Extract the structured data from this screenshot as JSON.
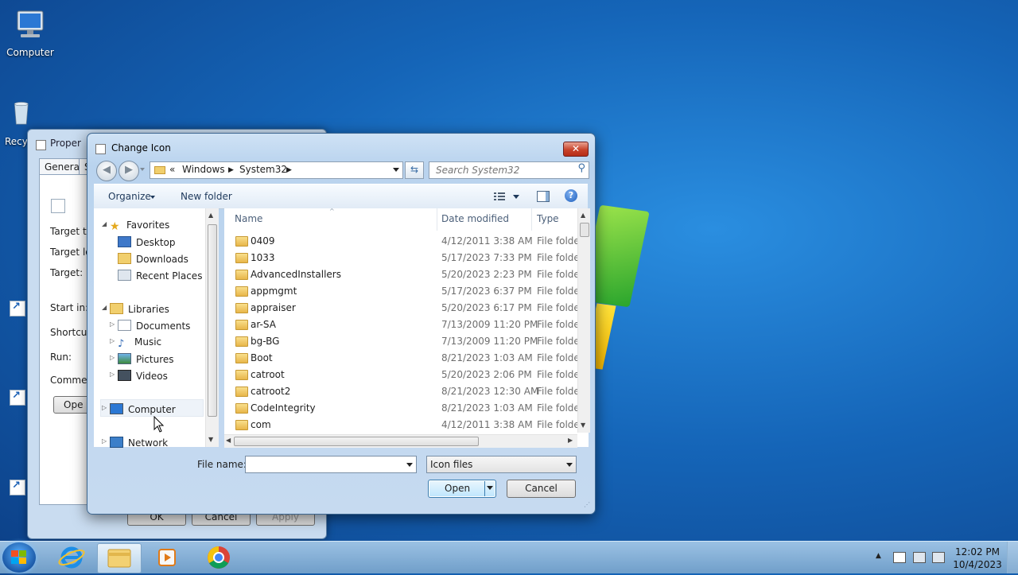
{
  "desktop": {
    "icons": [
      {
        "label": "Computer"
      },
      {
        "label": "Recy"
      }
    ]
  },
  "properties_window": {
    "title": "Proper",
    "tabs": [
      "General",
      "S"
    ],
    "labels": [
      "Target ty",
      "Target lo",
      "Target:",
      "Start in:",
      "Shortcut",
      "Run:",
      "Commen"
    ],
    "open_button": "Ope",
    "buttons": {
      "ok": "OK",
      "cancel": "Cancel",
      "apply": "Apply"
    }
  },
  "dialog": {
    "title": "Change Icon",
    "close": "✕",
    "address": {
      "chevron": "«",
      "segments": [
        "Windows",
        "System32"
      ]
    },
    "search": {
      "placeholder": "Search System32"
    },
    "toolbar": {
      "organize": "Organize",
      "new_folder": "New folder",
      "help": "?"
    },
    "tree": {
      "favorites": "Favorites",
      "desktop": "Desktop",
      "downloads": "Downloads",
      "recent": "Recent Places",
      "libraries": "Libraries",
      "documents": "Documents",
      "music": "Music",
      "pictures": "Pictures",
      "videos": "Videos",
      "computer": "Computer",
      "network": "Network"
    },
    "columns": {
      "name": "Name",
      "date": "Date modified",
      "type": "Type"
    },
    "files": [
      {
        "name": "0409",
        "date": "4/12/2011 3:38 AM",
        "type": "File folde"
      },
      {
        "name": "1033",
        "date": "5/17/2023 7:33 PM",
        "type": "File folde"
      },
      {
        "name": "AdvancedInstallers",
        "date": "5/20/2023 2:23 PM",
        "type": "File folde"
      },
      {
        "name": "appmgmt",
        "date": "5/17/2023 6:37 PM",
        "type": "File folde"
      },
      {
        "name": "appraiser",
        "date": "5/20/2023 6:17 PM",
        "type": "File folde"
      },
      {
        "name": "ar-SA",
        "date": "7/13/2009 11:20 PM",
        "type": "File folde"
      },
      {
        "name": "bg-BG",
        "date": "7/13/2009 11:20 PM",
        "type": "File folde"
      },
      {
        "name": "Boot",
        "date": "8/21/2023 1:03 AM",
        "type": "File folde"
      },
      {
        "name": "catroot",
        "date": "5/20/2023 2:06 PM",
        "type": "File folde"
      },
      {
        "name": "catroot2",
        "date": "8/21/2023 12:30 AM",
        "type": "File folde"
      },
      {
        "name": "CodeIntegrity",
        "date": "8/21/2023 1:03 AM",
        "type": "File folde"
      },
      {
        "name": "com",
        "date": "4/12/2011 3:38 AM",
        "type": "File folde"
      }
    ],
    "file_name": {
      "label": "File name:",
      "value": ""
    },
    "file_type": {
      "value": "Icon files"
    },
    "buttons": {
      "open": "Open",
      "cancel": "Cancel"
    }
  },
  "taskbar": {
    "clock": {
      "time": "12:02 PM",
      "date": "10/4/2023"
    },
    "tray_arrow": "▲"
  }
}
